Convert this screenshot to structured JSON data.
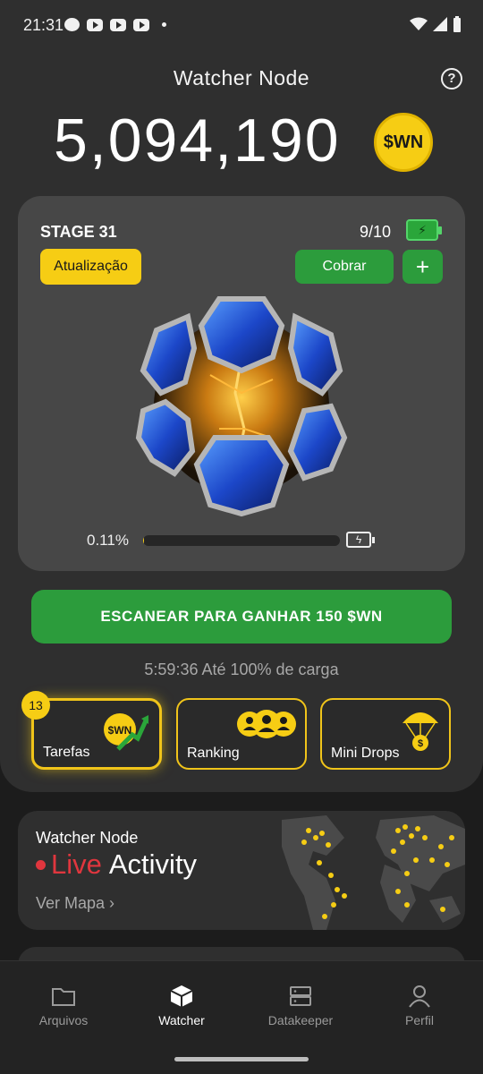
{
  "status_bar": {
    "time": "21:31"
  },
  "header": {
    "title": "Watcher Node",
    "balance": "5,094,190",
    "coin_label": "$WN"
  },
  "stage": {
    "label": "STAGE 31",
    "count": "9/10",
    "update_label": "Atualização",
    "claim_label": "Cobrar",
    "plus_label": "+",
    "progress_text": "0.11%",
    "progress_fraction": 0.0011
  },
  "scan": {
    "button_label": "ESCANEAR PARA GANHAR 150 $WN",
    "charge_text": "5:59:36 Até 100% de carga"
  },
  "tiles": [
    {
      "label": "Tarefas",
      "badge": "13",
      "icon": "wn-coin-arrow-icon"
    },
    {
      "label": "Ranking",
      "icon": "people-icon"
    },
    {
      "label": "Mini Drops",
      "icon": "parachute-icon"
    }
  ],
  "live": {
    "subtitle": "Watcher Node",
    "live_word": "Live",
    "activity_word": "Activity",
    "link_label": "Ver Mapa"
  },
  "nav": [
    {
      "label": "Arquivos",
      "icon": "folder-icon"
    },
    {
      "label": "Watcher",
      "icon": "cube-icon"
    },
    {
      "label": "Datakeeper",
      "icon": "server-icon"
    },
    {
      "label": "Perfil",
      "icon": "person-icon"
    }
  ],
  "colors": {
    "accent_yellow": "#f6cd14",
    "accent_green": "#2c9c3c",
    "live_red": "#e0363e"
  }
}
